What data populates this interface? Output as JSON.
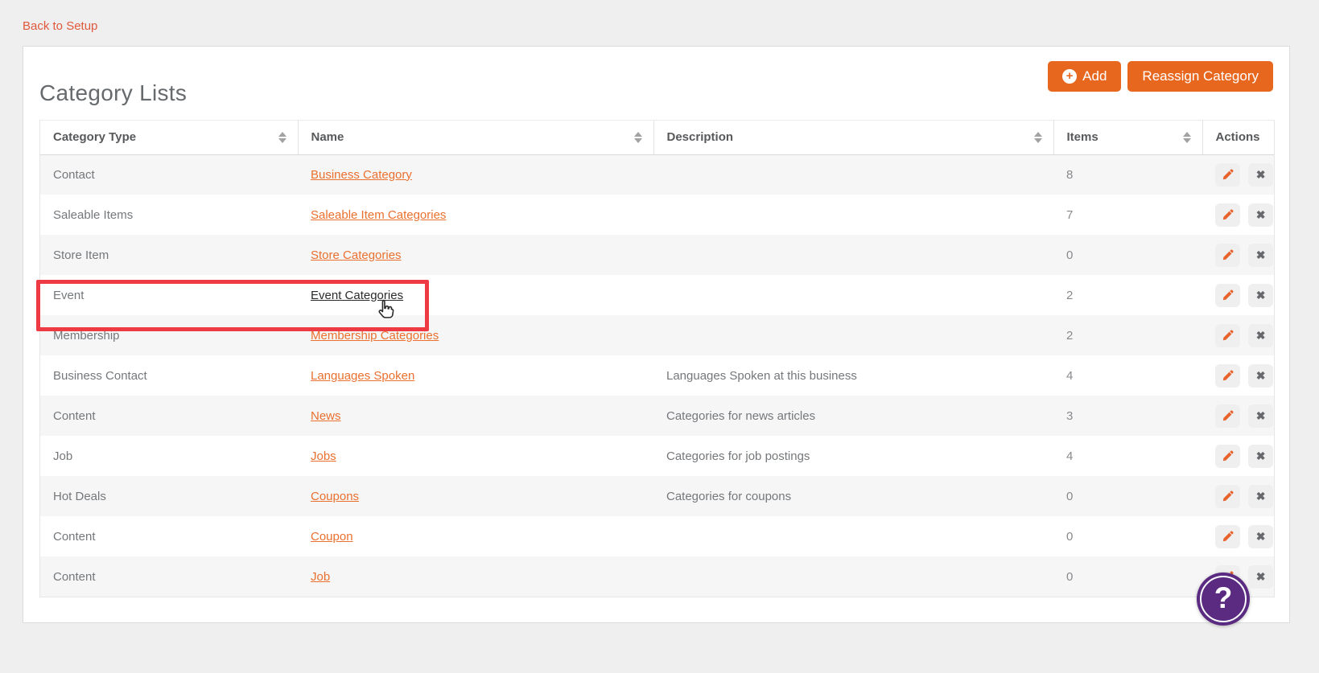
{
  "back_link": "Back to Setup",
  "page": {
    "title": "Category Lists"
  },
  "toolbar": {
    "add_label": "Add",
    "add_icon_glyph": "+",
    "reassign_label": "Reassign Category"
  },
  "table": {
    "columns": [
      {
        "label": "Category Type",
        "sortable": true
      },
      {
        "label": "Name",
        "sortable": true
      },
      {
        "label": "Description",
        "sortable": true
      },
      {
        "label": "Items",
        "sortable": true
      },
      {
        "label": "Actions",
        "sortable": false
      }
    ],
    "rows": [
      {
        "type": "Contact",
        "name": "Business Category",
        "description": "",
        "items": "8",
        "highlighted": false
      },
      {
        "type": "Saleable Items",
        "name": "Saleable Item Categories",
        "description": "",
        "items": "7",
        "highlighted": false
      },
      {
        "type": "Store Item",
        "name": "Store Categories",
        "description": "",
        "items": "0",
        "highlighted": false
      },
      {
        "type": "Event",
        "name": "Event Categories",
        "description": "",
        "items": "2",
        "highlighted": true
      },
      {
        "type": "Membership",
        "name": "Membership Categories",
        "description": "",
        "items": "2",
        "highlighted": false
      },
      {
        "type": "Business Contact",
        "name": "Languages Spoken",
        "description": "Languages Spoken at this business",
        "items": "4",
        "highlighted": false
      },
      {
        "type": "Content",
        "name": "News",
        "description": "Categories for news articles",
        "items": "3",
        "highlighted": false
      },
      {
        "type": "Job",
        "name": "Jobs",
        "description": "Categories for job postings",
        "items": "4",
        "highlighted": false
      },
      {
        "type": "Hot Deals",
        "name": "Coupons",
        "description": "Categories for coupons",
        "items": "0",
        "highlighted": false
      },
      {
        "type": "Content",
        "name": "Coupon",
        "description": "",
        "items": "0",
        "highlighted": false
      },
      {
        "type": "Content",
        "name": "Job",
        "description": "",
        "items": "0",
        "highlighted": false
      }
    ]
  },
  "row_actions": {
    "edit": "edit",
    "delete": "delete",
    "delete_glyph": "✖"
  },
  "help": {
    "label": "?"
  },
  "colors": {
    "accent": "#e8671f",
    "link": "#e9702e",
    "back_link": "#e0593c",
    "highlight_box": "#ee3b43",
    "help_purple": "#5a2b81",
    "stripe": "#f6f6f7"
  }
}
